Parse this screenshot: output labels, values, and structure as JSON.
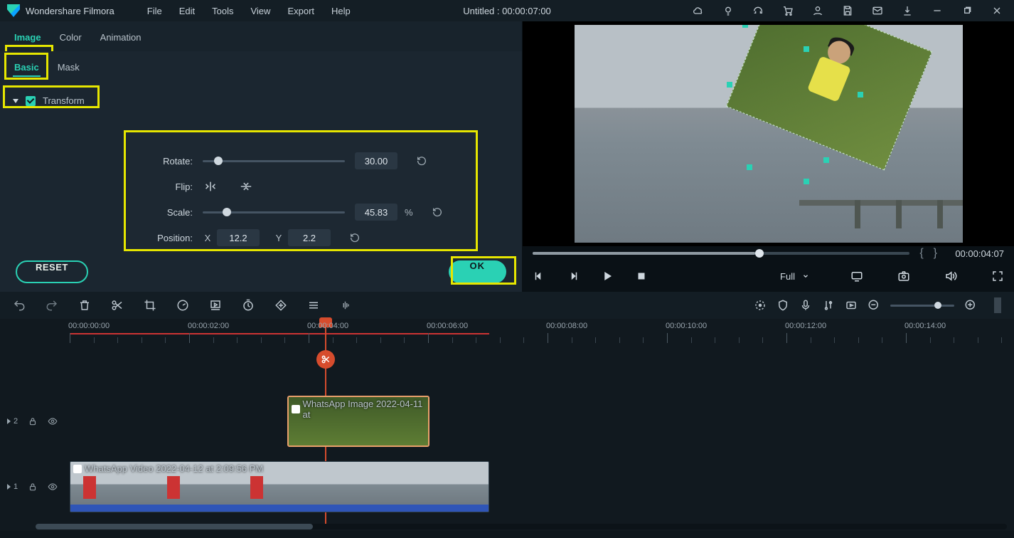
{
  "app": {
    "brand": "Wondershare Filmora",
    "title": "Untitled : 00:00:07:00"
  },
  "menus": {
    "file": "File",
    "edit": "Edit",
    "tools": "Tools",
    "view": "View",
    "export": "Export",
    "help": "Help"
  },
  "tabs1": {
    "image": "Image",
    "color": "Color",
    "animation": "Animation"
  },
  "tabs2": {
    "basic": "Basic",
    "mask": "Mask"
  },
  "section": {
    "transform": "Transform"
  },
  "transform": {
    "rotate_label": "Rotate:",
    "rotate_value": "30.00",
    "rotate_pct": 8,
    "flip_label": "Flip:",
    "scale_label": "Scale:",
    "scale_value": "45.83",
    "scale_unit": "%",
    "scale_pct": 14,
    "position_label": "Position:",
    "x_label": "X",
    "x_value": "12.2",
    "y_label": "Y",
    "y_value": "2.2"
  },
  "buttons": {
    "reset": "RESET",
    "ok": "OK"
  },
  "preview": {
    "time": "00:00:04:07",
    "size_label": "Full"
  },
  "ruler": {
    "labels": [
      "00:00:00:00",
      "00:00:02:00",
      "00:00:04:00",
      "00:00:06:00",
      "00:00:08:00",
      "00:00:10:00",
      "00:00:12:00",
      "00:00:14:00"
    ]
  },
  "tracks": {
    "t2_label": "2",
    "t1_label": "1",
    "clip2_name": "WhatsApp Image 2022-04-11 at",
    "clip1_name": "WhatsApp Video 2022-04-12 at 2:09:56 PM"
  }
}
